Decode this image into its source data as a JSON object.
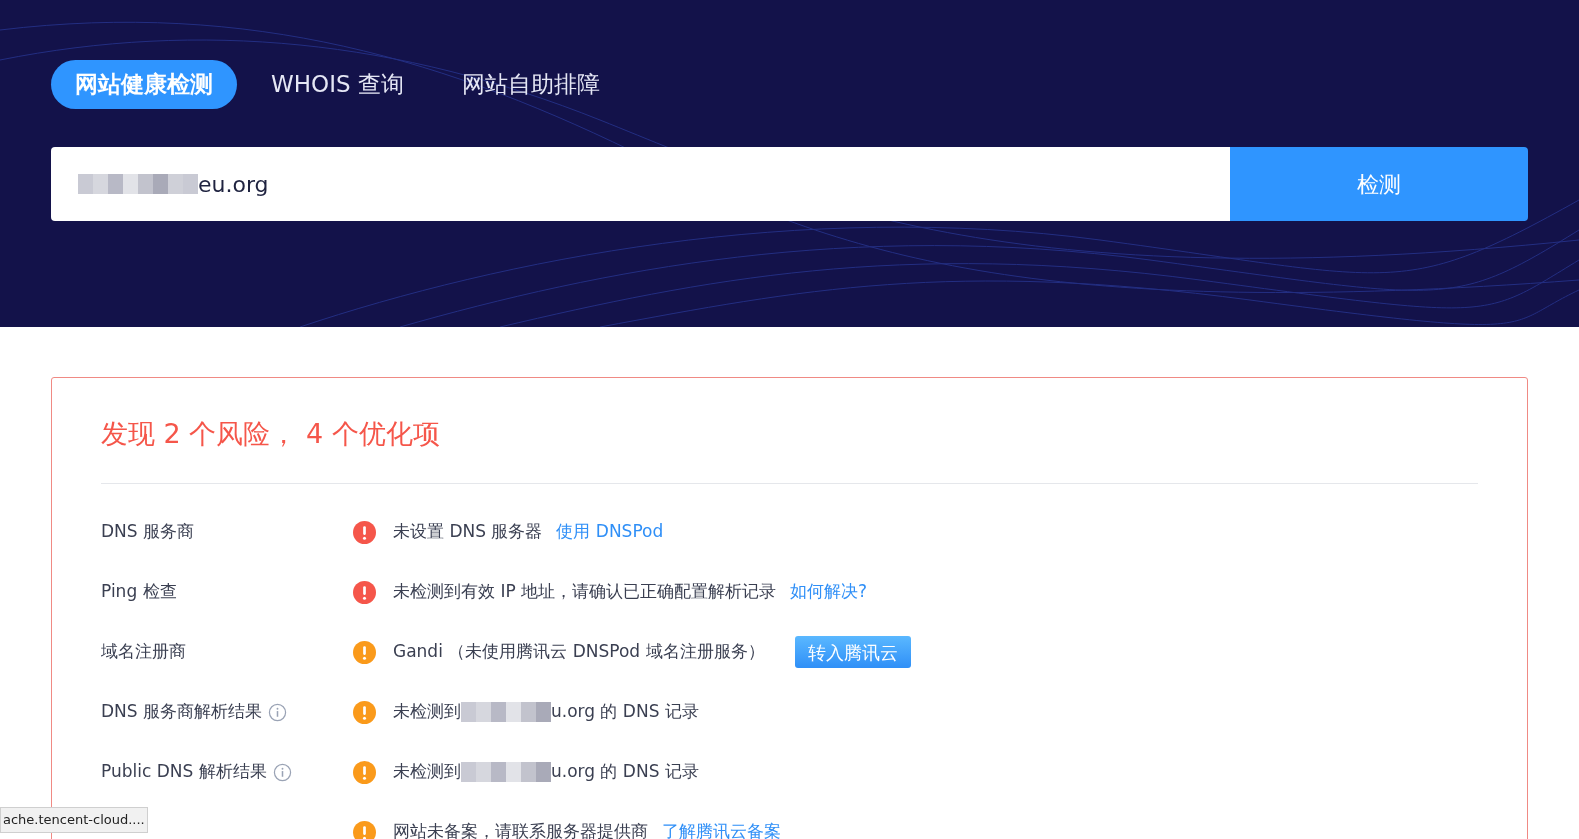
{
  "tabs": [
    {
      "label": "网站健康检测",
      "selected": true
    },
    {
      "label": "WHOIS 查询",
      "selected": false
    },
    {
      "label": "网站自助排障",
      "selected": false
    }
  ],
  "search": {
    "value": "eu.org",
    "redacted": true,
    "button": "检测"
  },
  "report": {
    "title": "发现 2 个风险， 4 个优化项",
    "rows": [
      {
        "label": "DNS 服务商",
        "info": false,
        "kind": "risk",
        "message": "未设置 DNS 服务器",
        "link": "使用 DNSPod"
      },
      {
        "label": "Ping 检查",
        "info": false,
        "kind": "risk",
        "message": "未检测到有效 IP 地址，请确认已正确配置解析记录",
        "link": "如何解决?"
      },
      {
        "label": "域名注册商",
        "info": false,
        "kind": "warning",
        "message": "Gandi （未使用腾讯云 DNSPod 域名注册服务）",
        "button": "转入腾讯云"
      },
      {
        "label": "DNS 服务商解析结果",
        "info": true,
        "kind": "warning",
        "message": "未检测到",
        "redacted": true,
        "message_after": "u.org 的 DNS 记录"
      },
      {
        "label": "Public DNS 解析结果",
        "info": true,
        "kind": "warning",
        "message": "未检测到",
        "redacted": true,
        "message_after": "u.org 的 DNS 记录"
      },
      {
        "kind": "warning",
        "message": "网站未备案，请联系服务器提供商",
        "link": "了解腾讯云备案"
      }
    ]
  },
  "status_bar": "ache.tencent-cloud...."
}
